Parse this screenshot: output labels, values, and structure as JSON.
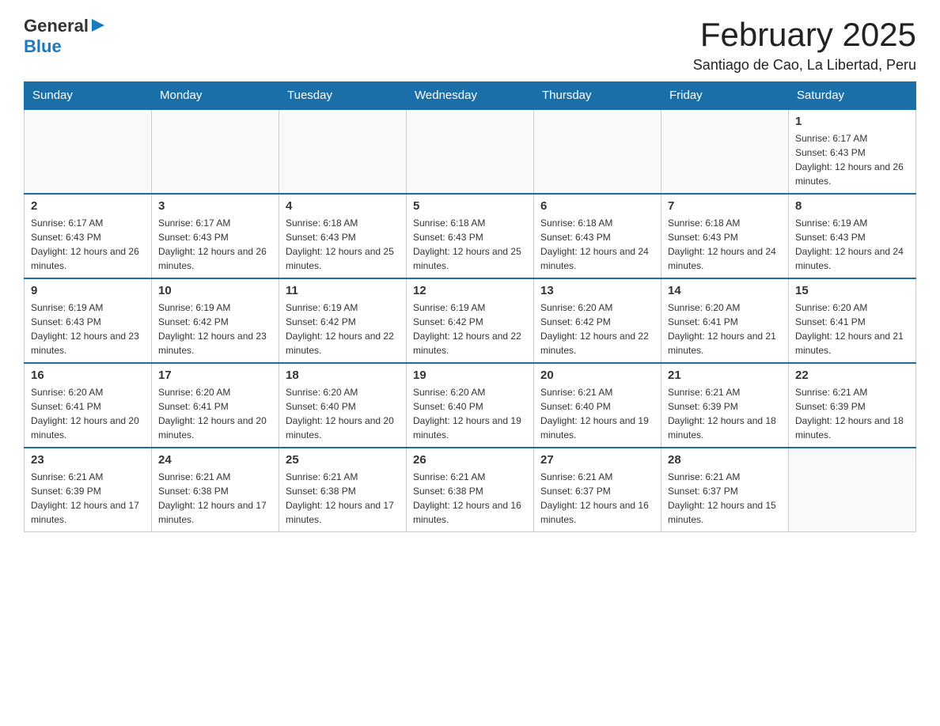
{
  "logo": {
    "general": "General",
    "blue": "Blue",
    "arrow": "▶"
  },
  "title": "February 2025",
  "subtitle": "Santiago de Cao, La Libertad, Peru",
  "days_header": [
    "Sunday",
    "Monday",
    "Tuesday",
    "Wednesday",
    "Thursday",
    "Friday",
    "Saturday"
  ],
  "weeks": [
    [
      {
        "day": "",
        "info": ""
      },
      {
        "day": "",
        "info": ""
      },
      {
        "day": "",
        "info": ""
      },
      {
        "day": "",
        "info": ""
      },
      {
        "day": "",
        "info": ""
      },
      {
        "day": "",
        "info": ""
      },
      {
        "day": "1",
        "info": "Sunrise: 6:17 AM\nSunset: 6:43 PM\nDaylight: 12 hours and 26 minutes."
      }
    ],
    [
      {
        "day": "2",
        "info": "Sunrise: 6:17 AM\nSunset: 6:43 PM\nDaylight: 12 hours and 26 minutes."
      },
      {
        "day": "3",
        "info": "Sunrise: 6:17 AM\nSunset: 6:43 PM\nDaylight: 12 hours and 26 minutes."
      },
      {
        "day": "4",
        "info": "Sunrise: 6:18 AM\nSunset: 6:43 PM\nDaylight: 12 hours and 25 minutes."
      },
      {
        "day": "5",
        "info": "Sunrise: 6:18 AM\nSunset: 6:43 PM\nDaylight: 12 hours and 25 minutes."
      },
      {
        "day": "6",
        "info": "Sunrise: 6:18 AM\nSunset: 6:43 PM\nDaylight: 12 hours and 24 minutes."
      },
      {
        "day": "7",
        "info": "Sunrise: 6:18 AM\nSunset: 6:43 PM\nDaylight: 12 hours and 24 minutes."
      },
      {
        "day": "8",
        "info": "Sunrise: 6:19 AM\nSunset: 6:43 PM\nDaylight: 12 hours and 24 minutes."
      }
    ],
    [
      {
        "day": "9",
        "info": "Sunrise: 6:19 AM\nSunset: 6:43 PM\nDaylight: 12 hours and 23 minutes."
      },
      {
        "day": "10",
        "info": "Sunrise: 6:19 AM\nSunset: 6:42 PM\nDaylight: 12 hours and 23 minutes."
      },
      {
        "day": "11",
        "info": "Sunrise: 6:19 AM\nSunset: 6:42 PM\nDaylight: 12 hours and 22 minutes."
      },
      {
        "day": "12",
        "info": "Sunrise: 6:19 AM\nSunset: 6:42 PM\nDaylight: 12 hours and 22 minutes."
      },
      {
        "day": "13",
        "info": "Sunrise: 6:20 AM\nSunset: 6:42 PM\nDaylight: 12 hours and 22 minutes."
      },
      {
        "day": "14",
        "info": "Sunrise: 6:20 AM\nSunset: 6:41 PM\nDaylight: 12 hours and 21 minutes."
      },
      {
        "day": "15",
        "info": "Sunrise: 6:20 AM\nSunset: 6:41 PM\nDaylight: 12 hours and 21 minutes."
      }
    ],
    [
      {
        "day": "16",
        "info": "Sunrise: 6:20 AM\nSunset: 6:41 PM\nDaylight: 12 hours and 20 minutes."
      },
      {
        "day": "17",
        "info": "Sunrise: 6:20 AM\nSunset: 6:41 PM\nDaylight: 12 hours and 20 minutes."
      },
      {
        "day": "18",
        "info": "Sunrise: 6:20 AM\nSunset: 6:40 PM\nDaylight: 12 hours and 20 minutes."
      },
      {
        "day": "19",
        "info": "Sunrise: 6:20 AM\nSunset: 6:40 PM\nDaylight: 12 hours and 19 minutes."
      },
      {
        "day": "20",
        "info": "Sunrise: 6:21 AM\nSunset: 6:40 PM\nDaylight: 12 hours and 19 minutes."
      },
      {
        "day": "21",
        "info": "Sunrise: 6:21 AM\nSunset: 6:39 PM\nDaylight: 12 hours and 18 minutes."
      },
      {
        "day": "22",
        "info": "Sunrise: 6:21 AM\nSunset: 6:39 PM\nDaylight: 12 hours and 18 minutes."
      }
    ],
    [
      {
        "day": "23",
        "info": "Sunrise: 6:21 AM\nSunset: 6:39 PM\nDaylight: 12 hours and 17 minutes."
      },
      {
        "day": "24",
        "info": "Sunrise: 6:21 AM\nSunset: 6:38 PM\nDaylight: 12 hours and 17 minutes."
      },
      {
        "day": "25",
        "info": "Sunrise: 6:21 AM\nSunset: 6:38 PM\nDaylight: 12 hours and 17 minutes."
      },
      {
        "day": "26",
        "info": "Sunrise: 6:21 AM\nSunset: 6:38 PM\nDaylight: 12 hours and 16 minutes."
      },
      {
        "day": "27",
        "info": "Sunrise: 6:21 AM\nSunset: 6:37 PM\nDaylight: 12 hours and 16 minutes."
      },
      {
        "day": "28",
        "info": "Sunrise: 6:21 AM\nSunset: 6:37 PM\nDaylight: 12 hours and 15 minutes."
      },
      {
        "day": "",
        "info": ""
      }
    ]
  ]
}
